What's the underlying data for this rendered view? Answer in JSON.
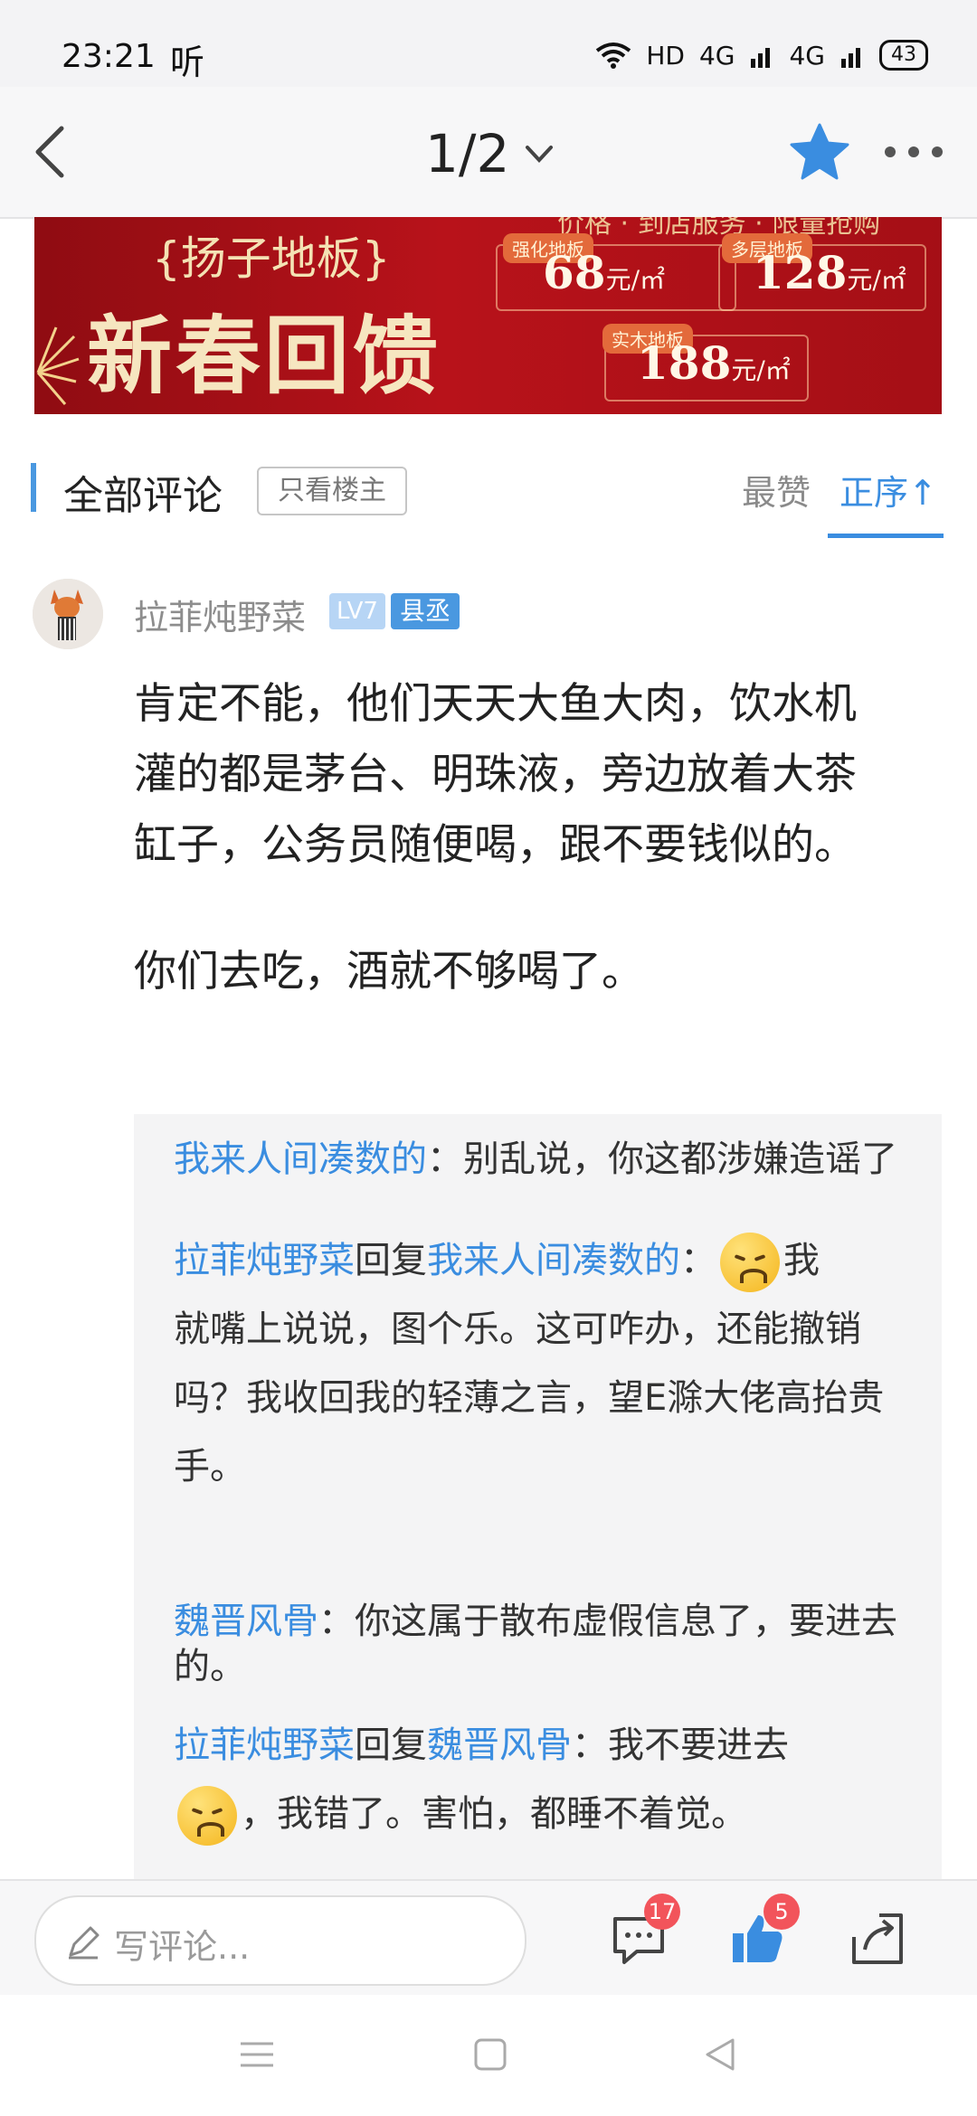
{
  "status": {
    "time": "23:21",
    "carrier": "听",
    "network": "HD",
    "signal1": "4G",
    "signal2": "4G",
    "battery": "43"
  },
  "nav": {
    "page_indicator": "1/2"
  },
  "banner": {
    "brand": "{扬子地板}",
    "headline": "新春回馈",
    "toptext": "价格 · 到店服务 · 限量抢购",
    "products": [
      {
        "tag": "强化地板",
        "price": "68",
        "unit": "元/㎡"
      },
      {
        "tag": "多层地板",
        "price": "128",
        "unit": "元/㎡"
      },
      {
        "tag": "实木地板",
        "price": "188",
        "unit": "元/㎡"
      }
    ]
  },
  "comments_header": {
    "title": "全部评论",
    "only_op": "只看楼主",
    "sort_hot": "最赞",
    "sort_order": "正序↑"
  },
  "comment": {
    "username": "拉菲炖野菜",
    "level": "LV7",
    "rank": "县丞",
    "paragraphs": [
      "肯定不能，他们天天大鱼大肉，饮水机灌的都是茅台、明珠液，旁边放着大茶缸子，公务员随便喝，跟不要钱似的。",
      "你们去吃，酒就不够喝了。"
    ]
  },
  "replies": [
    {
      "user": "我来人间凑数的",
      "text": "：别乱说，你这都涉嫌造谣了"
    },
    {
      "user": "拉菲炖野菜",
      "reply_word": "回复",
      "target": "我来人间凑数的",
      "colon": "：",
      "after_emoji": "我",
      "text": "就嘴上说说，图个乐。这可咋办，还能撤销吗？我收回我的轻薄之言，望E滁大佬高抬贵手。"
    },
    {
      "user": "魏晋风骨",
      "text": "：你这属于散布虚假信息了，要进去的。"
    },
    {
      "user": "拉菲炖野菜",
      "reply_word": "回复",
      "target": "魏晋风骨",
      "text": "：我不要进去",
      "after_emoji": "，我错了。害怕，都睡不着觉。"
    }
  ],
  "actions": {
    "comment_placeholder": "写评论...",
    "comment_count": "17",
    "like_count": "5"
  },
  "colors": {
    "accent": "#3a8de0",
    "badge": "#f2545b",
    "banner_red": "#b8121a",
    "star": "#3a8de0"
  }
}
